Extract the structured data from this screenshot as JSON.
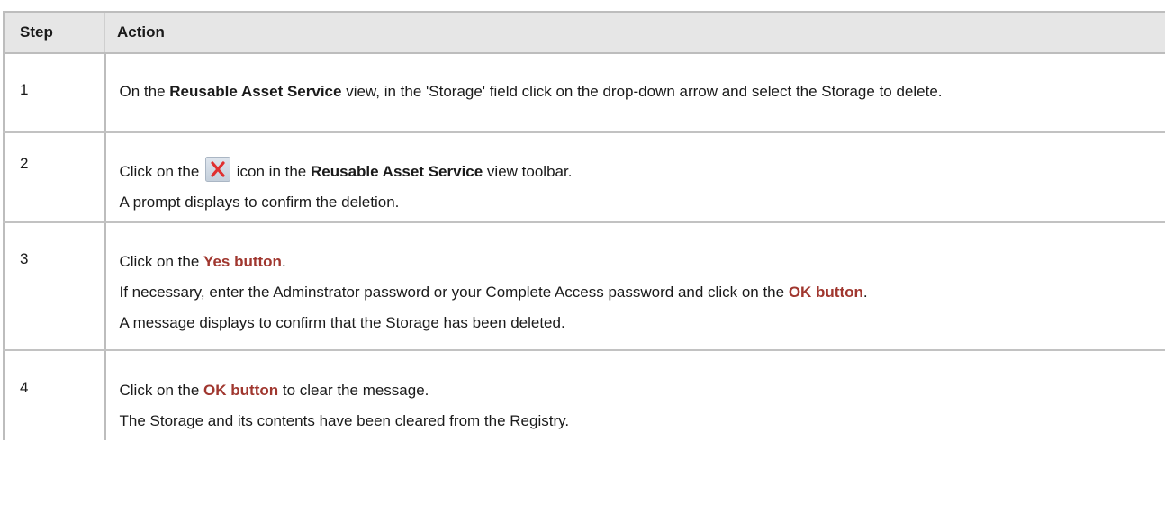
{
  "table": {
    "headers": {
      "step": "Step",
      "action": "Action"
    },
    "rows": [
      {
        "step": "1",
        "line1": {
          "a": "On the ",
          "b": "Reusable Asset Service",
          "c": " view, in the 'Storage' field click on the drop-down arrow and select the Storage to delete."
        }
      },
      {
        "step": "2",
        "line1": {
          "a": "Click on the ",
          "icon": "delete-x-icon",
          "b": " icon in the ",
          "c": "Reusable Asset Service",
          "d": " view toolbar."
        },
        "line2": "A prompt displays to confirm the deletion."
      },
      {
        "step": "3",
        "line1": {
          "a": "Click on the ",
          "btn": "Yes button",
          "b": "."
        },
        "line2": {
          "a": "If necessary, enter the Adminstrator password or your Complete Access password and click on the ",
          "btn": "OK button",
          "b": "."
        },
        "line3": "A message displays to confirm that the Storage has been deleted."
      },
      {
        "step": "4",
        "line1": {
          "a": "Click on the ",
          "btn": "OK button",
          "b": " to clear the message."
        },
        "line2": "The Storage and its contents have been cleared from the Registry."
      }
    ]
  },
  "colors": {
    "header_bg": "#e6e6e6",
    "ui_button_text": "#a0372f",
    "delete_icon": "#e03030",
    "border": "#bdbdbd"
  }
}
